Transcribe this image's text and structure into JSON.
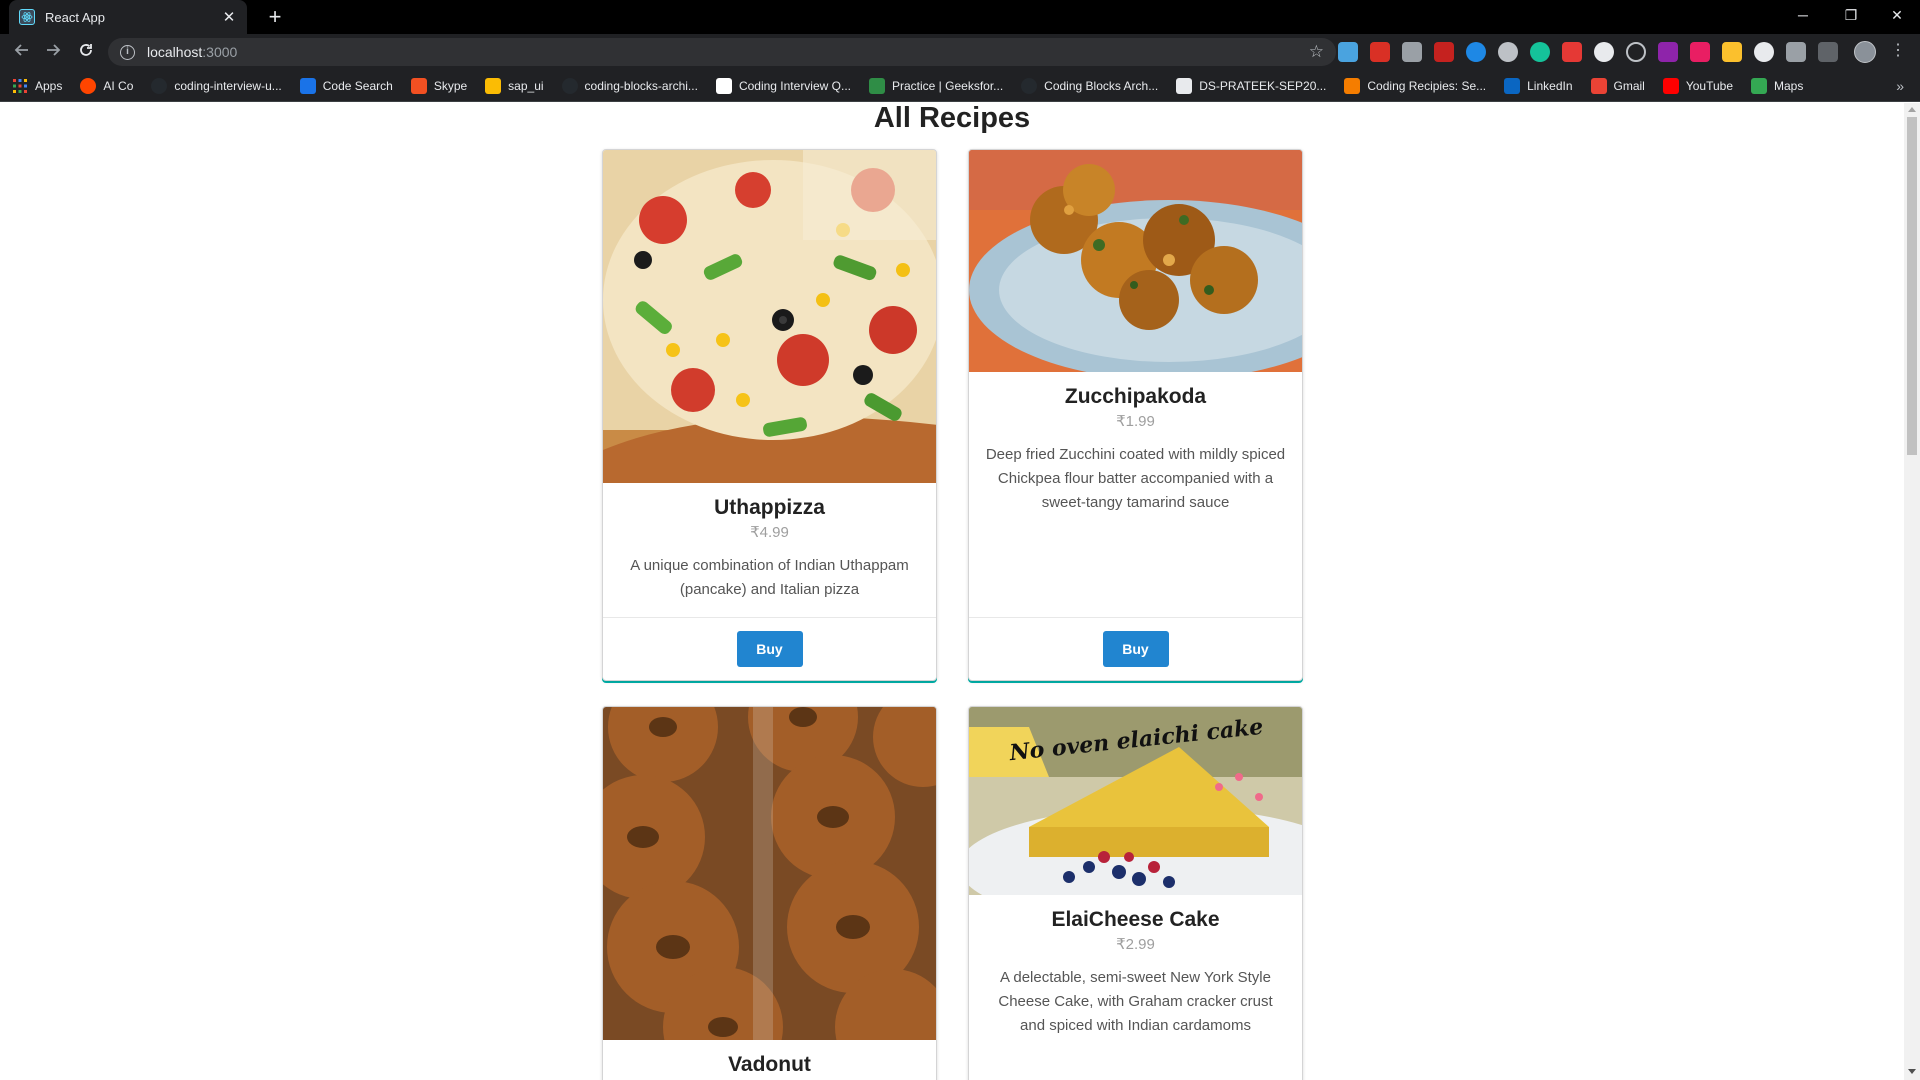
{
  "browser": {
    "tab_title": "React App",
    "new_tab_symbol": "+",
    "close_symbol": "✕",
    "url_host": "localhost",
    "url_port": ":3000",
    "window_controls": {
      "minimize": "─",
      "restore": "❐",
      "close": "✕"
    }
  },
  "bookmarks": [
    {
      "label": "Apps",
      "icon": "apps-grid-icon",
      "color": "#ea4335"
    },
    {
      "label": "AI Co",
      "icon": "reddit-icon",
      "color": "#ff4500"
    },
    {
      "label": "coding-interview-u...",
      "icon": "github-icon",
      "color": "#24292e"
    },
    {
      "label": "Code Search",
      "icon": "code-search-icon",
      "color": "#1a73e8"
    },
    {
      "label": "Skype",
      "icon": "microsoft-icon",
      "color": "#f25022"
    },
    {
      "label": "sap_ui",
      "icon": "folder-icon",
      "color": "#fbbc04"
    },
    {
      "label": "coding-blocks-archi...",
      "icon": "github-icon",
      "color": "#24292e"
    },
    {
      "label": "Coding Interview Q...",
      "icon": "document-icon",
      "color": "#ffffff"
    },
    {
      "label": "Practice | Geeksfor...",
      "icon": "geeksforgeeks-icon",
      "color": "#2f8d46"
    },
    {
      "label": "Coding Blocks Arch...",
      "icon": "github-icon",
      "color": "#24292e"
    },
    {
      "label": "DS-PRATEEK-SEP20...",
      "icon": "image-icon",
      "color": "#e8eaed"
    },
    {
      "label": "Coding Recipies: Se...",
      "icon": "blogger-icon",
      "color": "#f57d00"
    },
    {
      "label": "LinkedIn",
      "icon": "linkedin-icon",
      "color": "#0a66c2"
    },
    {
      "label": "Gmail",
      "icon": "gmail-icon",
      "color": "#ea4335"
    },
    {
      "label": "YouTube",
      "icon": "youtube-icon",
      "color": "#ff0000"
    },
    {
      "label": "Maps",
      "icon": "maps-icon",
      "color": "#34a853"
    }
  ],
  "page": {
    "title": "All Recipes",
    "buy_label": "Buy"
  },
  "recipes": [
    {
      "name": "Uthappizza",
      "price": "₹4.99",
      "description": "A unique combination of Indian Uthappam (pancake) and Italian pizza",
      "image": "pizza-photo"
    },
    {
      "name": "Zucchipakoda",
      "price": "₹1.99",
      "description": "Deep fried Zucchini coated with mildly spiced Chickpea flour batter accompanied with a sweet-tangy tamarind sauce",
      "image": "pakoda-photo"
    },
    {
      "name": "Vadonut",
      "price": "",
      "description": "",
      "image": "donut-photo"
    },
    {
      "name": "ElaiCheese Cake",
      "price": "₹2.99",
      "description": "A delectable, semi-sweet New York Style Cheese Cake, with Graham cracker crust and spiced with Indian cardamoms",
      "image": "cheesecake-photo",
      "image_caption": "No oven elaichi cake"
    }
  ],
  "colors": {
    "buy_button": "#2185d0",
    "card_accent": "#00b5ad",
    "title": "#222222"
  }
}
